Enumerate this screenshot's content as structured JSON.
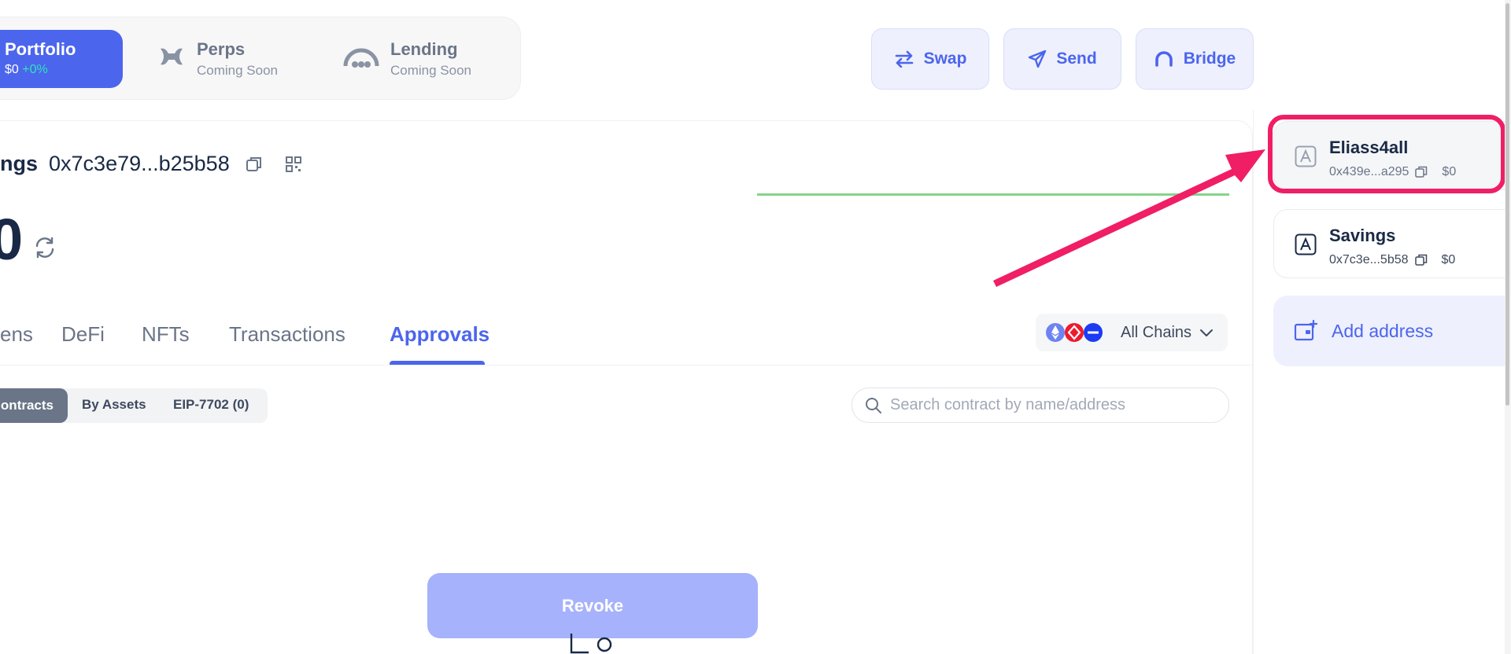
{
  "nav": {
    "portfolio": {
      "label": "Portfolio",
      "value": "$0",
      "change": "+0%"
    },
    "perps": {
      "label": "Perps",
      "status": "Coming Soon"
    },
    "lending": {
      "label": "Lending",
      "status": "Coming Soon"
    }
  },
  "actions": {
    "swap": "Swap",
    "send": "Send",
    "bridge": "Bridge"
  },
  "account": {
    "name_partial": "ngs",
    "address": "0x7c3e79...b25b58",
    "balance_partial": "0"
  },
  "tabs": [
    {
      "label": "ens"
    },
    {
      "label": "DeFi"
    },
    {
      "label": "NFTs"
    },
    {
      "label": "Transactions"
    },
    {
      "label": "Approvals",
      "active": true
    }
  ],
  "chains": {
    "label": "All Chains"
  },
  "subfilter": {
    "contracts": "ontracts",
    "assets": "By Assets",
    "eip": "EIP-7702 (0)"
  },
  "search": {
    "placeholder": "Search contract by name/address"
  },
  "revoke": {
    "label": "Revoke"
  },
  "sidebar": {
    "addresses": [
      {
        "name": "Eliass4all",
        "address": "0x439e...a295",
        "balance": "$0",
        "selected": true
      },
      {
        "name": "Savings",
        "address": "0x7c3e...5b58",
        "balance": "$0",
        "selected": false
      }
    ],
    "add_label": "Add address"
  },
  "colors": {
    "accent": "#4c65ed",
    "highlight": "#f01e65",
    "sparkline": "#86d38a"
  }
}
